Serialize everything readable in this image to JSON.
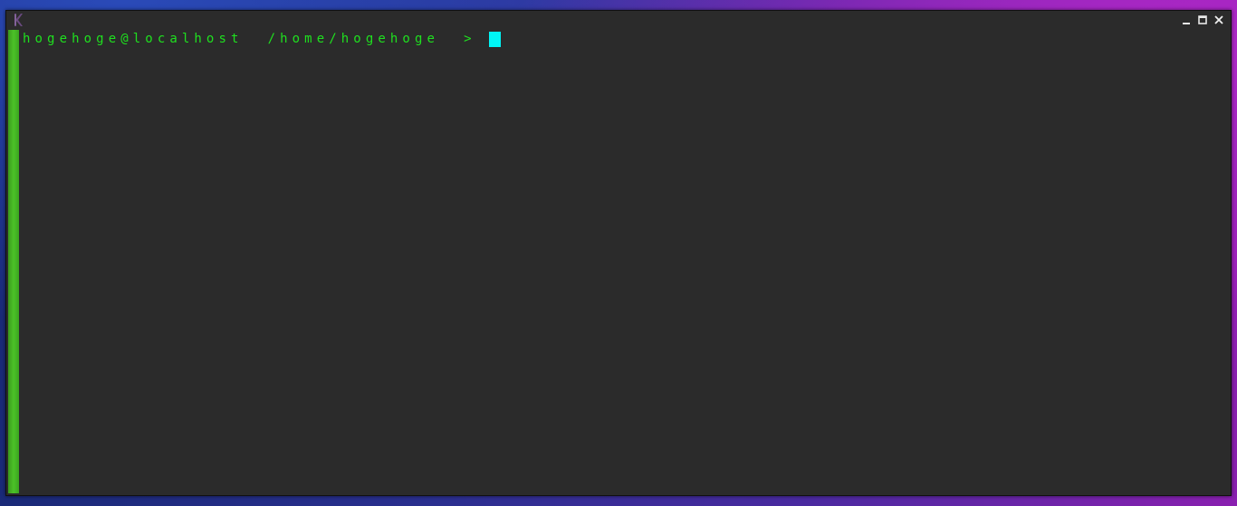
{
  "window": {
    "app_icon": "terminal-app-icon",
    "controls": {
      "minimize_icon": "minimize-icon",
      "maximize_icon": "maximize-icon",
      "close_icon": "close-icon"
    }
  },
  "terminal": {
    "prompt_user_host": "hogehoge@localhost",
    "prompt_path": "/home/hogehoge",
    "prompt_symbol": ">",
    "input_text": "",
    "colors": {
      "prompt_text": "#1fe01f",
      "cursor": "#00f5f5",
      "left_bar": "#4cc228",
      "background": "#2b2b2b"
    }
  }
}
